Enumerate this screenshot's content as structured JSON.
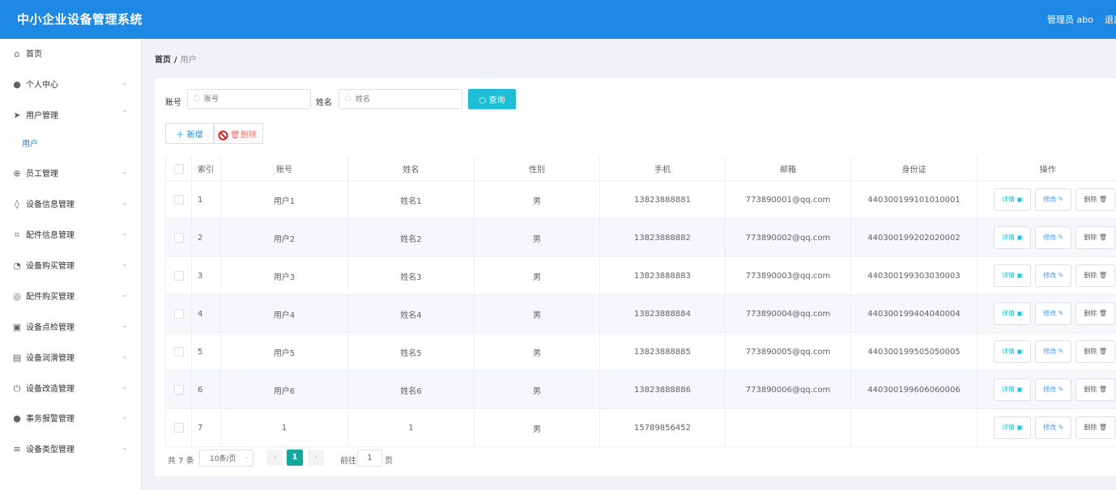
{
  "app": {
    "title": "中小企业设备管理系统",
    "user": "管理员 abo",
    "logout": "退出"
  },
  "sidebar": {
    "items": [
      {
        "label": "首页",
        "icon": "home-icon",
        "glyph": "⌂",
        "arrow": ""
      },
      {
        "label": "个人中心",
        "icon": "user-icon",
        "glyph": "●",
        "arrow": "⌄"
      },
      {
        "label": "用户管理",
        "icon": "send-icon",
        "glyph": "➤",
        "arrow": "⌃"
      },
      {
        "label": "用户",
        "icon": "",
        "glyph": "",
        "arrow": "",
        "sub": true
      },
      {
        "label": "员工管理",
        "icon": "target-icon",
        "glyph": "⊕",
        "arrow": "⌄"
      },
      {
        "label": "设备信息管理",
        "icon": "bulb-icon",
        "glyph": "◊",
        "arrow": "⌄"
      },
      {
        "label": "配件信息管理",
        "icon": "crop-icon",
        "glyph": "⌗",
        "arrow": "⌄"
      },
      {
        "label": "设备购买管理",
        "icon": "clock-icon",
        "glyph": "◔",
        "arrow": "⌄"
      },
      {
        "label": "配件购买管理",
        "icon": "coin-icon",
        "glyph": "◎",
        "arrow": "⌄"
      },
      {
        "label": "设备点检管理",
        "icon": "clipboard-icon",
        "glyph": "▣",
        "arrow": "⌄"
      },
      {
        "label": "设备润滑管理",
        "icon": "chart-icon",
        "glyph": "▤",
        "arrow": "⌄"
      },
      {
        "label": "设备改造管理",
        "icon": "power-icon",
        "glyph": "⏻",
        "arrow": "⌄"
      },
      {
        "label": "事务报警管理",
        "icon": "person-icon",
        "glyph": "●",
        "arrow": "⌄"
      },
      {
        "label": "设备类型管理",
        "icon": "menu-icon",
        "glyph": "≡",
        "arrow": "⌄"
      }
    ]
  },
  "breadcrumb": {
    "home": "首页",
    "sep": "/",
    "current": "用户"
  },
  "search": {
    "account_label": "账号",
    "account_placeholder": "账号",
    "name_label": "姓名",
    "name_placeholder": "姓名",
    "query_button": "查询"
  },
  "toolbar": {
    "add": "新增",
    "delete": "删除"
  },
  "table": {
    "headers": [
      "",
      "索引",
      "账号",
      "姓名",
      "性别",
      "手机",
      "邮箱",
      "身份证",
      "操作"
    ],
    "rows": [
      {
        "index": "1",
        "account": "用户1",
        "name": "姓名1",
        "gender": "男",
        "phone": "13823888881",
        "email": "773890001@qq.com",
        "idcard": "440300199101010001"
      },
      {
        "index": "2",
        "account": "用户2",
        "name": "姓名2",
        "gender": "男",
        "phone": "13823888882",
        "email": "773890002@qq.com",
        "idcard": "440300199202020002"
      },
      {
        "index": "3",
        "account": "用户3",
        "name": "姓名3",
        "gender": "男",
        "phone": "13823888883",
        "email": "773890003@qq.com",
        "idcard": "440300199303030003"
      },
      {
        "index": "4",
        "account": "用户4",
        "name": "姓名4",
        "gender": "男",
        "phone": "13823888884",
        "email": "773890004@qq.com",
        "idcard": "440300199404040004"
      },
      {
        "index": "5",
        "account": "用户5",
        "name": "姓名5",
        "gender": "男",
        "phone": "13823888885",
        "email": "773890005@qq.com",
        "idcard": "440300199505050005"
      },
      {
        "index": "6",
        "account": "用户6",
        "name": "姓名6",
        "gender": "男",
        "phone": "13823888886",
        "email": "773890006@qq.com",
        "idcard": "440300199606060006"
      },
      {
        "index": "7",
        "account": "1",
        "name": "1",
        "gender": "男",
        "phone": "15789856452",
        "email": "",
        "idcard": ""
      }
    ],
    "actions": {
      "detail": "详情",
      "edit": "修改",
      "delete": "删除"
    }
  },
  "pagination": {
    "total": "共 7 条",
    "page_size": "10条/页",
    "prev": "‹",
    "current": "1",
    "next": "›",
    "goto": "前往",
    "goto_value": "1",
    "page_suffix": "页"
  },
  "colors": {
    "header": "#1e88e5",
    "primary": "#1e88e5",
    "query": "#1ebed6",
    "danger": "#f56c6c",
    "active_page": "#13a89e"
  }
}
